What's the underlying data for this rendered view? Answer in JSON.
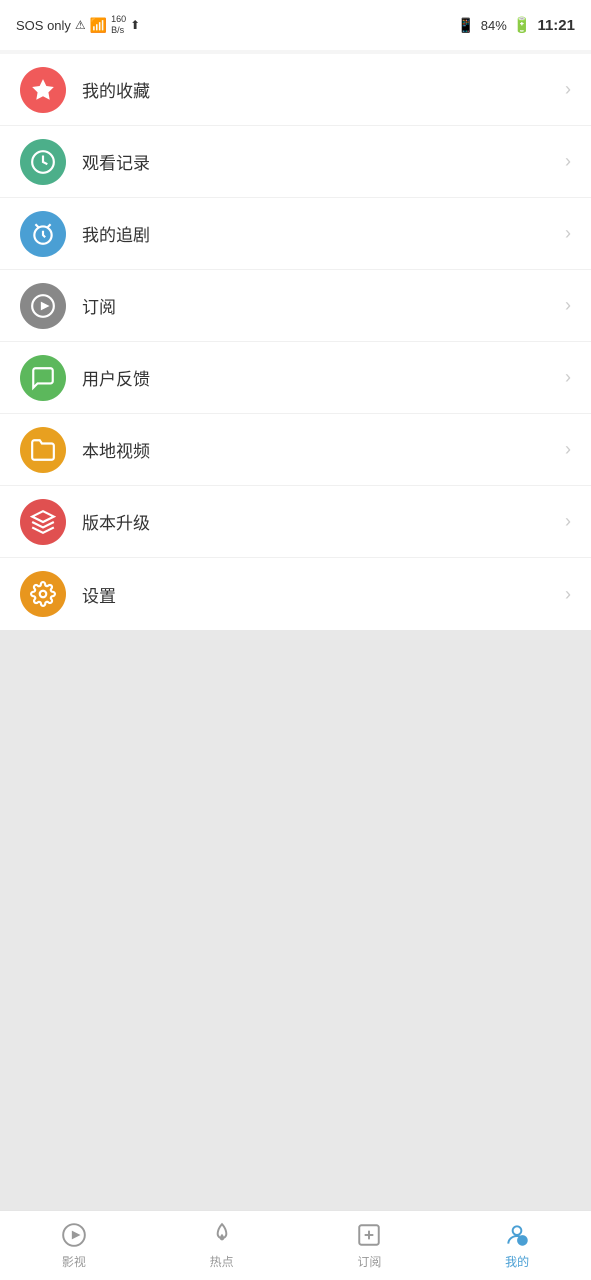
{
  "statusBar": {
    "left": {
      "sosText": "SOS only",
      "speed": "160\nB/s"
    },
    "right": {
      "battery": "84%",
      "time": "11:21"
    }
  },
  "menuItems": [
    {
      "id": "favorites",
      "label": "我的收藏",
      "iconColor": "icon-red",
      "iconType": "star"
    },
    {
      "id": "history",
      "label": "观看记录",
      "iconColor": "icon-green",
      "iconType": "clock"
    },
    {
      "id": "series",
      "label": "我的追剧",
      "iconColor": "icon-blue",
      "iconType": "alarm"
    },
    {
      "id": "subscribe",
      "label": "订阅",
      "iconColor": "icon-gray",
      "iconType": "play"
    },
    {
      "id": "feedback",
      "label": "用户反馈",
      "iconColor": "icon-green2",
      "iconType": "feedback"
    },
    {
      "id": "local",
      "label": "本地视频",
      "iconColor": "icon-orange",
      "iconType": "folder"
    },
    {
      "id": "update",
      "label": "版本升级",
      "iconColor": "icon-red2",
      "iconType": "layers"
    },
    {
      "id": "settings",
      "label": "设置",
      "iconColor": "icon-orange2",
      "iconType": "gear"
    }
  ],
  "bottomNav": [
    {
      "id": "videos",
      "label": "影视",
      "active": false
    },
    {
      "id": "hot",
      "label": "热点",
      "active": false
    },
    {
      "id": "subscribe",
      "label": "订阅",
      "active": false
    },
    {
      "id": "mine",
      "label": "我的",
      "active": true
    }
  ]
}
